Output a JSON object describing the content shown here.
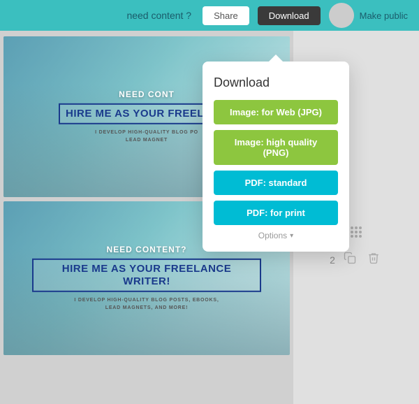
{
  "topbar": {
    "need_content_label": "need content ?",
    "share_label": "Share",
    "download_label": "Download",
    "make_public_label": "Make public"
  },
  "dropdown": {
    "title": "Download",
    "btn_jpg": "Image: for Web (JPG)",
    "btn_png": "Image: high quality (PNG)",
    "btn_pdf_standard": "PDF: standard",
    "btn_pdf_print": "PDF: for print",
    "options_label": "Options"
  },
  "card1": {
    "title": "NEED CONT",
    "headline": "HIRE ME AS YOUR FREELANC",
    "sub1": "I DEVELOP HIGH-QUALITY BLOG PO",
    "sub2": "LEAD MAGNET"
  },
  "card2": {
    "title": "NEED CONTENT?",
    "headline": "HIRE ME AS YOUR FREELANCE WRITER!",
    "sub1": "I DEVELOP HIGH-QUALITY BLOG POSTS, EBOOKS,",
    "sub2": "LEAD MAGNETS, AND MORE!"
  },
  "page_number": "2",
  "icons": {
    "copy": "⧉",
    "trash": "🗑"
  }
}
